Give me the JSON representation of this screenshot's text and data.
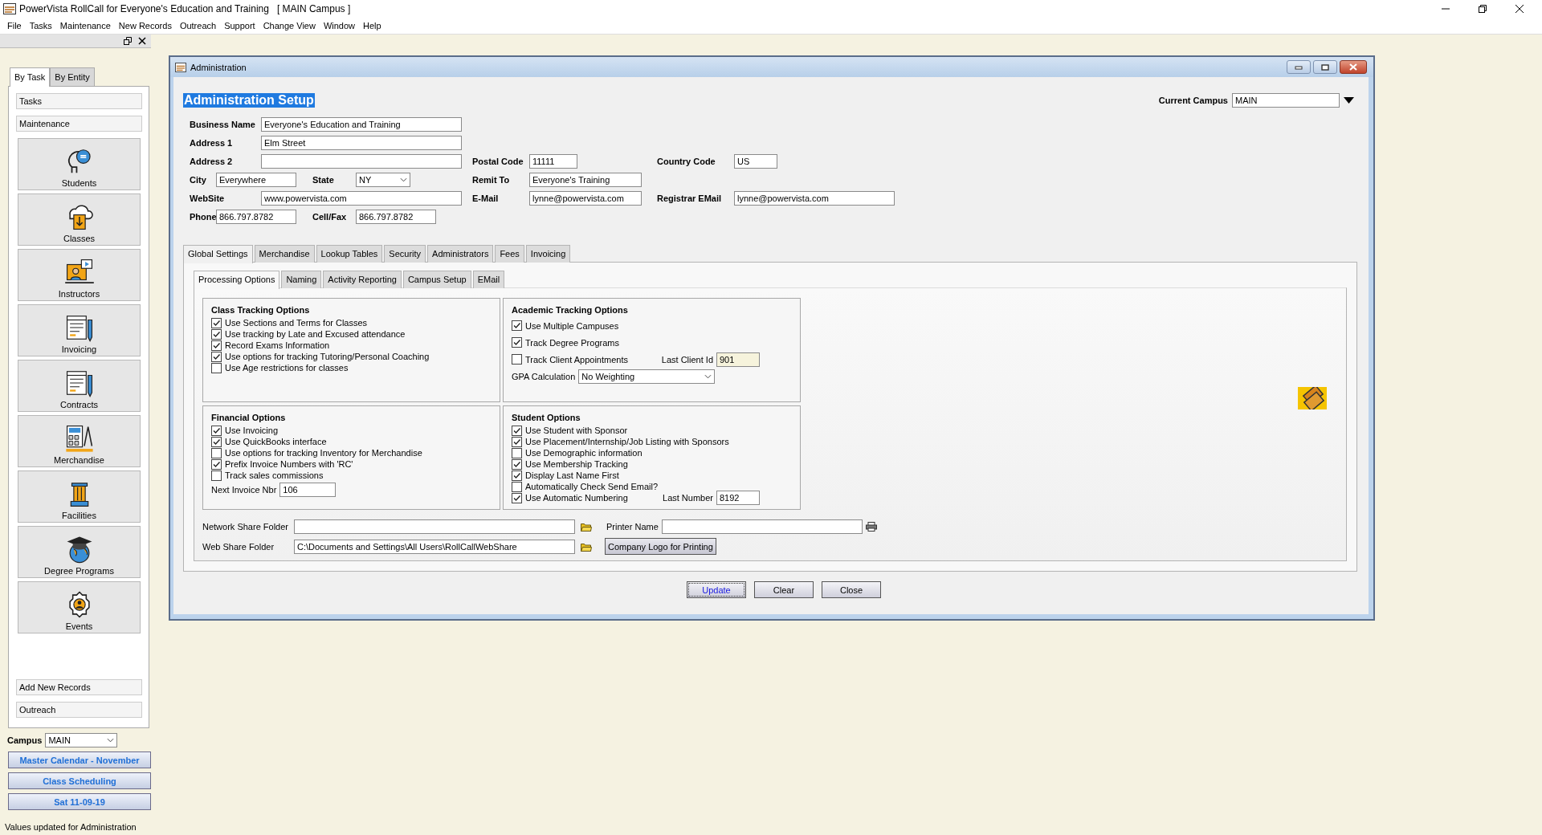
{
  "app": {
    "title": "PowerVista RollCall for Everyone's Education and Training   [ MAIN Campus ]",
    "menu": [
      "File",
      "Tasks",
      "Maintenance",
      "New Records",
      "Outreach",
      "Support",
      "Change View",
      "Window",
      "Help"
    ]
  },
  "sidebar": {
    "tabs": [
      {
        "label": "By Task",
        "selected": true
      },
      {
        "label": "By Entity",
        "selected": false
      }
    ],
    "top_sections": [
      "Tasks",
      "Maintenance"
    ],
    "items": [
      "Students",
      "Classes",
      "Instructors",
      "Invoicing",
      "Contracts",
      "Merchandise",
      "Facilities",
      "Degree Programs",
      "Events"
    ],
    "bottom_sections": [
      "Add New Records",
      "Outreach"
    ],
    "campus": {
      "label": "Campus",
      "value": "MAIN"
    },
    "links": [
      "Master Calendar - November",
      "Class Scheduling",
      "Sat 11-09-19"
    ]
  },
  "window": {
    "title": "Administration",
    "heading": "Administration Setup",
    "current_campus": {
      "label": "Current Campus",
      "value": "MAIN"
    },
    "rows": [
      {
        "left": [
          {
            "label": "Business Name",
            "value": "Everyone's Education and Training"
          }
        ]
      },
      {
        "left": [
          {
            "label": "Address 1",
            "value": "Elm Street"
          }
        ]
      },
      {
        "left": [
          {
            "label": "Address 2"
          }
        ],
        "middle": {
          "label": "Postal Code",
          "value": "11111"
        },
        "right": {
          "label": "Country Code",
          "value": "US"
        }
      },
      {
        "left": [
          {
            "label": "City",
            "value": "Everywhere"
          },
          {
            "label": "State",
            "value": "NY",
            "kind": "select"
          }
        ],
        "middle": {
          "label": "Remit To",
          "value": "Everyone's Training"
        }
      },
      {
        "left": [
          {
            "label": "WebSite",
            "value": "www.powervista.com"
          }
        ],
        "middle": {
          "label": "E-Mail",
          "value": "lynne@powervista.com"
        },
        "right": {
          "label": "Registrar EMail",
          "value": "lynne@powervista.com"
        }
      },
      {
        "left": [
          {
            "label": "Phone",
            "value": "866.797.8782"
          },
          {
            "label": "Cell/Fax",
            "value": "866.797.8782"
          }
        ]
      }
    ],
    "tabs": [
      {
        "label": "Global Settings",
        "selected": true
      },
      {
        "label": "Merchandise",
        "selected": false
      },
      {
        "label": "Lookup Tables",
        "selected": false
      },
      {
        "label": "Security",
        "selected": false
      },
      {
        "label": "Administrators",
        "selected": false
      },
      {
        "label": "Fees",
        "selected": false
      },
      {
        "label": "Invoicing",
        "selected": false
      }
    ],
    "subtabs": [
      {
        "label": "Processing Options",
        "selected": true
      },
      {
        "label": "Naming",
        "selected": false
      },
      {
        "label": "Activity Reporting",
        "selected": false
      },
      {
        "label": "Campus Setup",
        "selected": false
      },
      {
        "label": "EMail",
        "selected": false
      }
    ],
    "groups": [
      {
        "title": "Class Tracking Options",
        "options": [
          {
            "label": "Use Sections and Terms for Classes",
            "checked": true
          },
          {
            "label": "Use tracking by Late and Excused attendance",
            "checked": true
          },
          {
            "label": "Record Exams Information",
            "checked": true
          },
          {
            "label": "Use options for tracking Tutoring/Personal Coaching",
            "checked": true
          },
          {
            "label": "Use Age restrictions for classes",
            "checked": false
          }
        ]
      },
      {
        "title": "Academic Tracking Options",
        "options": [
          {
            "label": "Use Multiple Campuses",
            "checked": true
          },
          {
            "label": "Track Degree Programs",
            "checked": true
          },
          {
            "label": "Track Client Appointments",
            "checked": false,
            "field": {
              "label": "Last Client Id",
              "value": "901",
              "readonly": true
            }
          }
        ],
        "fields": [
          {
            "label": "GPA Calculation",
            "value": "No Weighting",
            "kind": "select"
          }
        ]
      },
      {
        "title": "Financial Options",
        "options": [
          {
            "label": "Use Invoicing",
            "checked": true
          },
          {
            "label": "Use QuickBooks interface",
            "checked": true
          },
          {
            "label": "Use options for tracking Inventory for Merchandise",
            "checked": false
          },
          {
            "label": "Prefix Invoice Numbers with 'RC'",
            "checked": true
          },
          {
            "label": "Track sales commissions",
            "checked": false
          }
        ],
        "fields": [
          {
            "label": "Next Invoice Nbr",
            "value": "106"
          }
        ]
      },
      {
        "title": "Student Options",
        "options": [
          {
            "label": "Use Student with Sponsor",
            "checked": true
          },
          {
            "label": "Use Placement/Internship/Job Listing with Sponsors",
            "checked": true
          },
          {
            "label": "Use Demographic information",
            "checked": false
          },
          {
            "label": "Use Membership Tracking",
            "checked": true
          },
          {
            "label": "Display Last Name First",
            "checked": true
          },
          {
            "label": "Automatically Check Send Email?",
            "checked": false
          },
          {
            "label": "Use Automatic Numbering",
            "checked": true,
            "field": {
              "label": "Last Number",
              "value": "8192",
              "readonly": false
            }
          }
        ]
      }
    ],
    "folders": [
      {
        "label": "Network Share Folder"
      },
      {
        "label": "Web Share Folder",
        "value": "C:\\Documents and Settings\\All Users\\RollCallWebShare"
      }
    ],
    "printer": {
      "label": "Printer Name"
    },
    "logo_button": "Company Logo for Printing",
    "buttons": [
      {
        "label": "Update",
        "focused": true
      },
      {
        "label": "Clear",
        "focused": false
      },
      {
        "label": "Close",
        "focused": false
      }
    ]
  },
  "status_bar": "Values updated for Administration"
}
